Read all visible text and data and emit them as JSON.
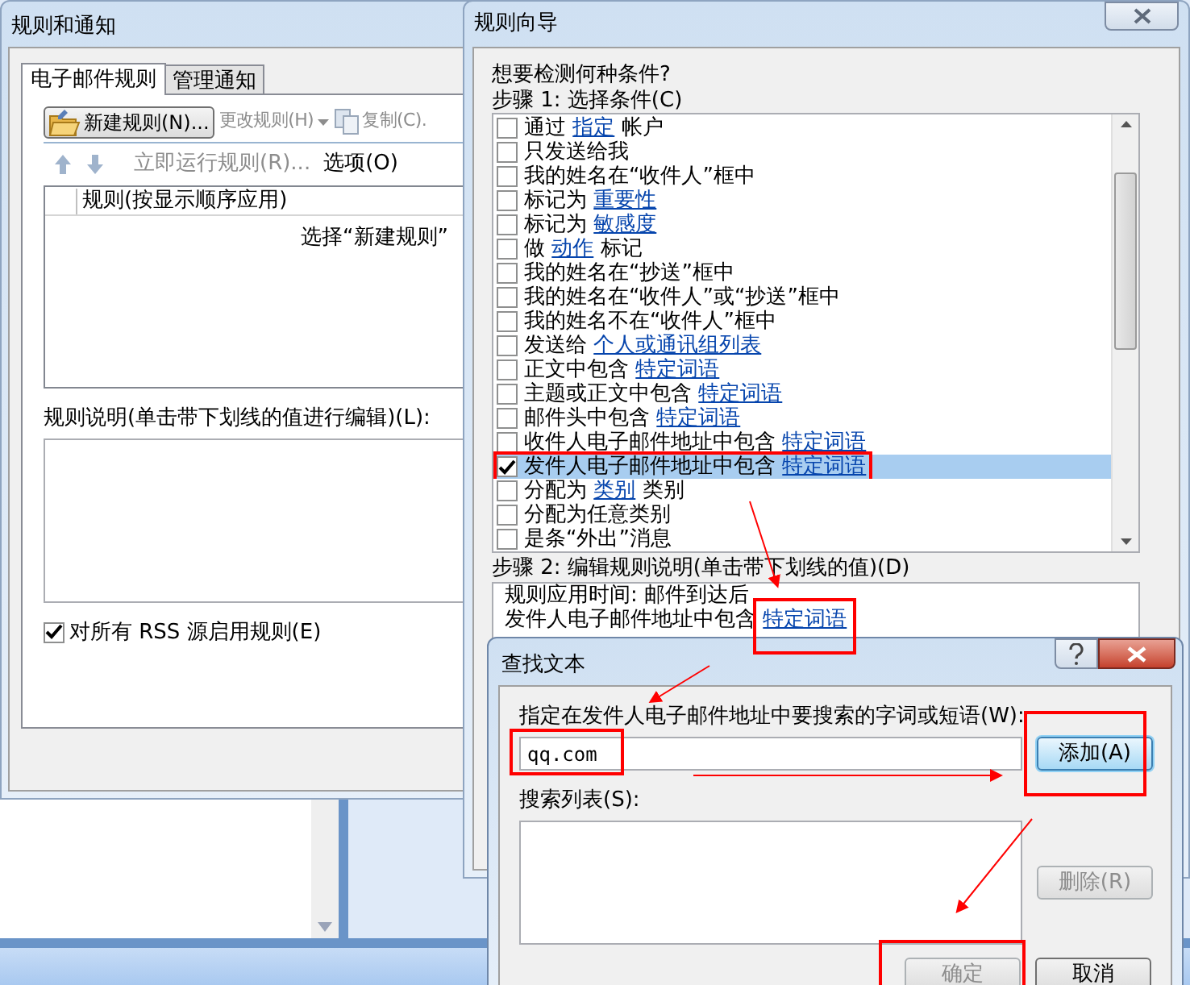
{
  "rules_and_alerts": {
    "title": "规则和通知",
    "tabs": [
      {
        "label": "电子邮件规则",
        "selected": true
      },
      {
        "label": "管理通知",
        "selected": false
      }
    ],
    "toolbar": [
      {
        "kind": "new",
        "label": "新建规则(N)...",
        "disabled": false
      },
      {
        "kind": "change",
        "label": "更改规则(H)",
        "disabled": true
      },
      {
        "kind": "copy",
        "label": "复制(C).",
        "disabled": true
      }
    ],
    "toolbar2": [
      {
        "kind": "up",
        "disabled": true
      },
      {
        "kind": "down",
        "disabled": true
      },
      {
        "kind": "run",
        "label": "立即运行规则(R)...",
        "disabled": true
      },
      {
        "kind": "options",
        "label": "选项(O)",
        "disabled": false
      }
    ],
    "list_header": "规则(按显示顺序应用)",
    "list_hint": "选择“新建规则”",
    "description_label": "规则说明(单击带下划线的值进行编辑)(L):",
    "rss_option": {
      "label": "对所有 RSS 源启用规则(E)",
      "checked": true
    }
  },
  "rules_wizard": {
    "title": "规则向导",
    "prompt": "想要检测何种条件?",
    "step1_label": "步骤 1: 选择条件(C)",
    "conditions": [
      {
        "parts": [
          {
            "kind": "text",
            "text": "通过"
          },
          {
            "kind": "link",
            "text": "指定"
          },
          {
            "kind": "text",
            "text": "帐户"
          }
        ],
        "checked": false,
        "selected": false
      },
      {
        "parts": [
          {
            "kind": "text",
            "text": "只发送给我"
          }
        ],
        "checked": false,
        "selected": false
      },
      {
        "parts": [
          {
            "kind": "text",
            "text": "我的姓名在“收件人”框中"
          }
        ],
        "checked": false,
        "selected": false
      },
      {
        "parts": [
          {
            "kind": "text",
            "text": "标记为"
          },
          {
            "kind": "link",
            "text": "重要性"
          }
        ],
        "checked": false,
        "selected": false
      },
      {
        "parts": [
          {
            "kind": "text",
            "text": "标记为"
          },
          {
            "kind": "link",
            "text": "敏感度"
          }
        ],
        "checked": false,
        "selected": false
      },
      {
        "parts": [
          {
            "kind": "text",
            "text": "做"
          },
          {
            "kind": "link",
            "text": "动作"
          },
          {
            "kind": "text",
            "text": "标记"
          }
        ],
        "checked": false,
        "selected": false
      },
      {
        "parts": [
          {
            "kind": "text",
            "text": "我的姓名在“抄送”框中"
          }
        ],
        "checked": false,
        "selected": false
      },
      {
        "parts": [
          {
            "kind": "text",
            "text": "我的姓名在“收件人”或“抄送”框中"
          }
        ],
        "checked": false,
        "selected": false
      },
      {
        "parts": [
          {
            "kind": "text",
            "text": "我的姓名不在“收件人”框中"
          }
        ],
        "checked": false,
        "selected": false
      },
      {
        "parts": [
          {
            "kind": "text",
            "text": "发送给"
          },
          {
            "kind": "link",
            "text": "个人或通讯组列表"
          }
        ],
        "checked": false,
        "selected": false
      },
      {
        "parts": [
          {
            "kind": "text",
            "text": "正文中包含"
          },
          {
            "kind": "link",
            "text": "特定词语"
          }
        ],
        "checked": false,
        "selected": false
      },
      {
        "parts": [
          {
            "kind": "text",
            "text": "主题或正文中包含"
          },
          {
            "kind": "link",
            "text": "特定词语"
          }
        ],
        "checked": false,
        "selected": false
      },
      {
        "parts": [
          {
            "kind": "text",
            "text": "邮件头中包含"
          },
          {
            "kind": "link",
            "text": "特定词语"
          }
        ],
        "checked": false,
        "selected": false
      },
      {
        "parts": [
          {
            "kind": "text",
            "text": "收件人电子邮件地址中包含"
          },
          {
            "kind": "link",
            "text": "特定词语"
          }
        ],
        "checked": false,
        "selected": false
      },
      {
        "parts": [
          {
            "kind": "text",
            "text": "发件人电子邮件地址中包含"
          },
          {
            "kind": "link",
            "text": "特定词语"
          }
        ],
        "checked": true,
        "selected": true
      },
      {
        "parts": [
          {
            "kind": "text",
            "text": "分配为"
          },
          {
            "kind": "link",
            "text": "类别"
          },
          {
            "kind": "text",
            "text": "类别"
          }
        ],
        "checked": false,
        "selected": false
      },
      {
        "parts": [
          {
            "kind": "text",
            "text": "分配为任意类别"
          }
        ],
        "checked": false,
        "selected": false
      },
      {
        "parts": [
          {
            "kind": "text",
            "text": "是条“外出”消息"
          }
        ],
        "checked": false,
        "selected": false
      }
    ],
    "step2_label": "步骤 2: 编辑规则说明(单击带下划线的值)(D)",
    "description": [
      {
        "parts": [
          {
            "kind": "text",
            "text": "规则应用时间: 邮件到达后"
          }
        ]
      },
      {
        "parts": [
          {
            "kind": "text",
            "text": "发件人电子邮件地址中包含"
          },
          {
            "kind": "link",
            "text": "特定词语"
          }
        ]
      }
    ]
  },
  "find_text": {
    "title": "查找文本",
    "field_label": "指定在发件人电子邮件地址中要搜索的字词或短语(W):",
    "value": "qq.com",
    "list_label": "搜索列表(S):",
    "buttons": [
      {
        "kind": "add",
        "label": "添加(A)",
        "disabled": false
      },
      {
        "kind": "remove",
        "label": "删除(R)",
        "disabled": true
      },
      {
        "kind": "ok",
        "label": "确定",
        "disabled": true
      },
      {
        "kind": "cancel",
        "label": "取消",
        "disabled": false
      }
    ]
  }
}
